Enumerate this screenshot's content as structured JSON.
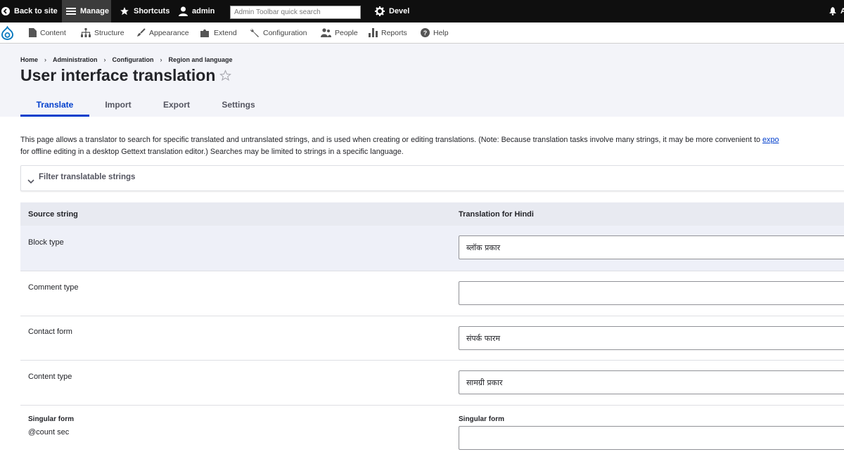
{
  "toolbar": {
    "back_to_site": "Back to site",
    "manage": "Manage",
    "shortcuts": "Shortcuts",
    "user": "admin",
    "search_placeholder": "Admin Toolbar quick search",
    "devel": "Devel",
    "right_partial": "A"
  },
  "tray": {
    "items": [
      "Content",
      "Structure",
      "Appearance",
      "Extend",
      "Configuration",
      "People",
      "Reports",
      "Help"
    ]
  },
  "breadcrumb": [
    "Home",
    "Administration",
    "Configuration",
    "Region and language"
  ],
  "page_title": "User interface translation",
  "tabs": [
    "Translate",
    "Import",
    "Export",
    "Settings"
  ],
  "description": {
    "line1": "This page allows a translator to search for specific translated and untranslated strings, and is used when creating or editing translations. (Note: Because translation tasks involve many strings, it may be more convenient to ",
    "link": "expo",
    "line2": "for offline editing in a desktop Gettext translation editor.) Searches may be limited to strings in a specific language."
  },
  "filter_label": "Filter translatable strings",
  "table": {
    "col_source": "Source string",
    "col_translation": "Translation for Hindi",
    "rows": [
      {
        "source": "Block type",
        "translation": "ब्लॉक प्रकार"
      },
      {
        "source": "Comment type",
        "translation": ""
      },
      {
        "source": "Contact form",
        "translation": "संपर्क फारम"
      },
      {
        "source": "Content type",
        "translation": "सामग्री प्रकार"
      }
    ],
    "plural_row": {
      "singular_label": "Singular form",
      "singular_value": "@count sec",
      "translation_singular_label": "Singular form"
    }
  }
}
